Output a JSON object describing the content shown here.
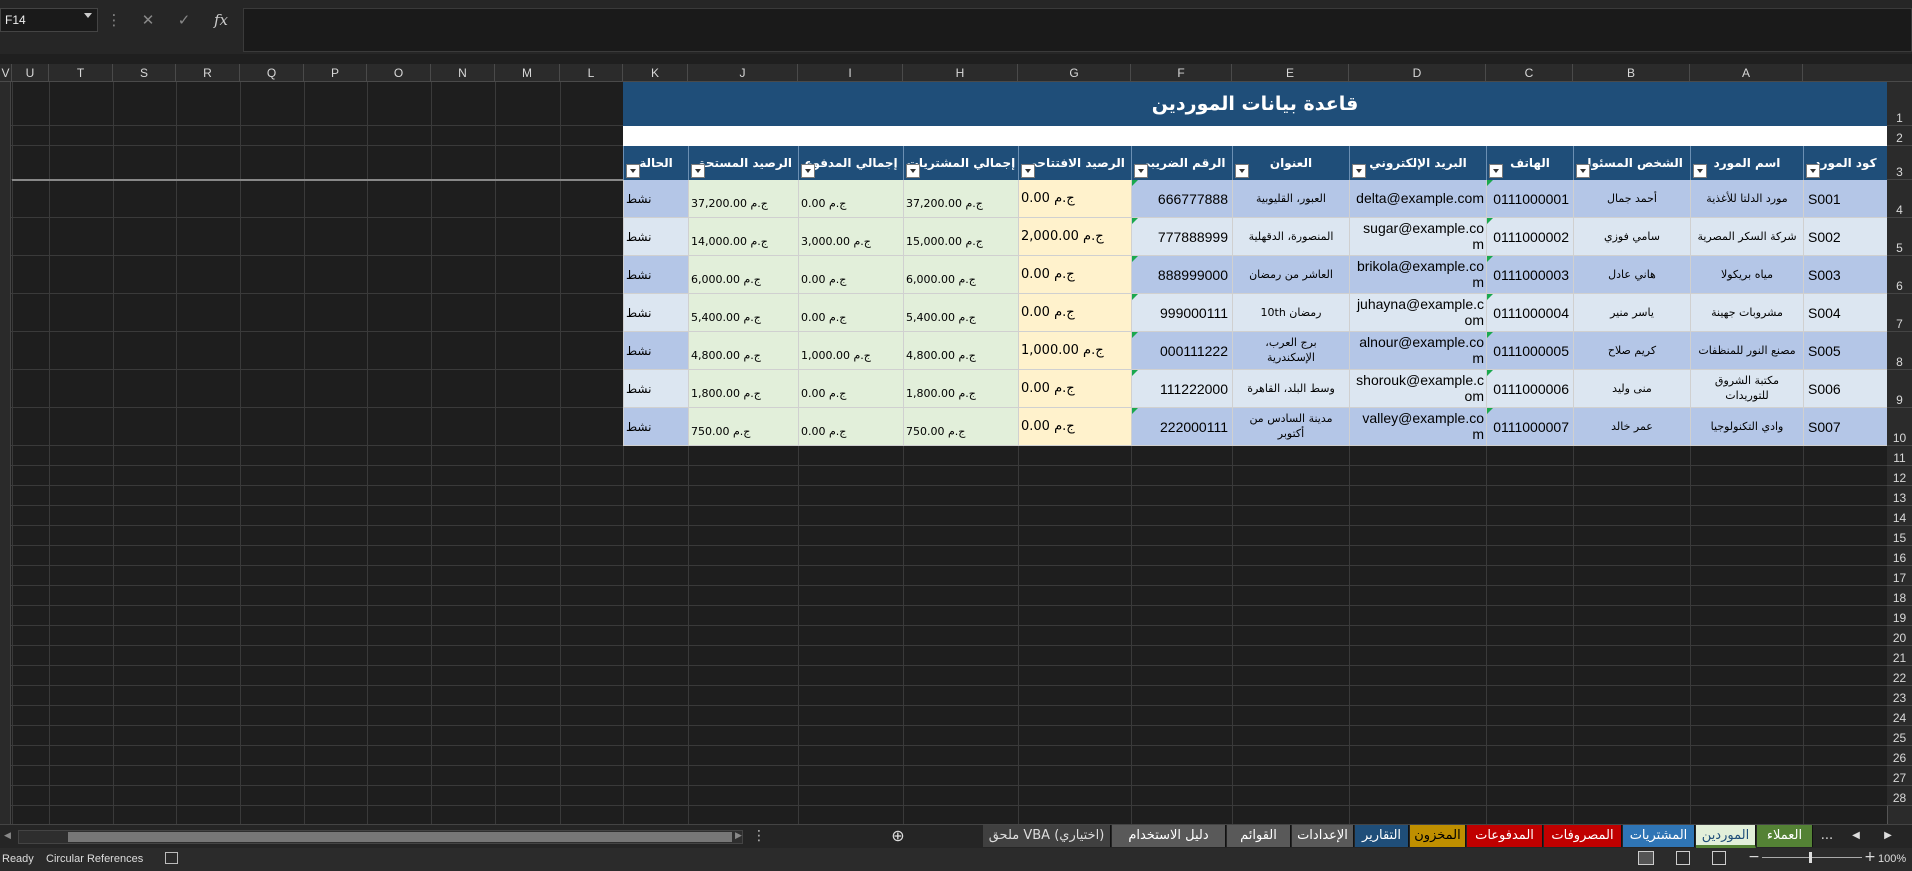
{
  "formula_bar": {
    "name_box": "F14",
    "fx_label": "fx",
    "cancel_icon": "✕",
    "enter_icon": "✓",
    "more_icon": "⋮",
    "formula": ""
  },
  "columns": [
    "V",
    "U",
    "T",
    "S",
    "R",
    "Q",
    "P",
    "O",
    "N",
    "M",
    "L",
    "K",
    "J",
    "I",
    "H",
    "G",
    "F",
    "E",
    "D",
    "C",
    "B",
    "A"
  ],
  "rows": [
    "1",
    "2",
    "3",
    "4",
    "5",
    "6",
    "7",
    "8",
    "9",
    "10",
    "11",
    "12",
    "13",
    "14",
    "15",
    "16",
    "17",
    "18",
    "19",
    "20",
    "21",
    "22",
    "23",
    "24",
    "25",
    "26",
    "27",
    "28"
  ],
  "sheet": {
    "title": "قاعدة بيانات الموردين",
    "headers": [
      "كود المورد",
      "اسم المورد",
      "الشخص المسئول",
      "الهاتف",
      "البريد الإلكتروني",
      "العنوان",
      "الرقم الضريبي",
      "الرصيد الافتتاحي",
      "إجمالي المشتريات",
      "إجمالي المدفوع",
      "الرصيد المستحق",
      "الحالة"
    ],
    "records": [
      {
        "code": "S001",
        "name": "مورد الدلتا للأغذية",
        "contact": "أحمد جمال",
        "phone": "0111000001",
        "email1": "delta@example.com",
        "email2": "",
        "address1": "العبور، القليوبية",
        "address2": "",
        "tax": "666777888",
        "opening": "ج.م 0.00",
        "purchases": "ج.م 37,200.00",
        "paid": "ج.م 0.00",
        "due": "ج.م 37,200.00",
        "status": "نشط"
      },
      {
        "code": "S002",
        "name": "شركة السكر المصرية",
        "contact": "سامي فوزي",
        "phone": "0111000002",
        "email1": "sugar@example.co",
        "email2": "m",
        "address1": "المنصورة، الدقهلية",
        "address2": "",
        "tax": "777888999",
        "opening": "ج.م 2,000.00",
        "purchases": "ج.م 15,000.00",
        "paid": "ج.م 3,000.00",
        "due": "ج.م 14,000.00",
        "status": "نشط"
      },
      {
        "code": "S003",
        "name": "مياه بريكولا",
        "contact": "هاني عادل",
        "phone": "0111000003",
        "email1": "brikola@example.co",
        "email2": "m",
        "address1": "العاشر من رمضان",
        "address2": "",
        "tax": "888999000",
        "opening": "ج.م 0.00",
        "purchases": "ج.م 6,000.00",
        "paid": "ج.م 0.00",
        "due": "ج.م 6,000.00",
        "status": "نشط"
      },
      {
        "code": "S004",
        "name": "مشروبات جهينة",
        "contact": "ياسر منير",
        "phone": "0111000004",
        "email1": "juhayna@example.c",
        "email2": "om",
        "address1": "رمضان 10th",
        "address2": "",
        "tax": "999000111",
        "opening": "ج.م 0.00",
        "purchases": "ج.م 5,400.00",
        "paid": "ج.م 0.00",
        "due": "ج.م 5,400.00",
        "status": "نشط"
      },
      {
        "code": "S005",
        "name": "مصنع النور للمنظفات",
        "contact": "كريم صلاح",
        "phone": "0111000005",
        "email1": "alnour@example.co",
        "email2": "m",
        "address1": "برج العرب،",
        "address2": "الإسكندرية",
        "tax": "000111222",
        "opening": "ج.م 1,000.00",
        "purchases": "ج.م 4,800.00",
        "paid": "ج.م 1,000.00",
        "due": "ج.م 4,800.00",
        "status": "نشط"
      },
      {
        "code": "S006",
        "name": "مكتبة الشروق",
        "name2": "للتوريدات",
        "contact": "منى وليد",
        "phone": "0111000006",
        "email1": "shorouk@example.c",
        "email2": "om",
        "address1": "وسط البلد، القاهرة",
        "address2": "",
        "tax": "111222000",
        "opening": "ج.م 0.00",
        "purchases": "ج.م 1,800.00",
        "paid": "ج.م 0.00",
        "due": "ج.م 1,800.00",
        "status": "نشط"
      },
      {
        "code": "S007",
        "name": "وادي التكنولوجيا",
        "contact": "عمر خالد",
        "phone": "0111000007",
        "email1": "valley@example.co",
        "email2": "m",
        "address1": "مدينة السادس من",
        "address2": "أكتوبر",
        "tax": "222000111",
        "opening": "ج.م 0.00",
        "purchases": "ج.م 750.00",
        "paid": "ج.م 0.00",
        "due": "ج.م 750.00",
        "status": "نشط"
      }
    ]
  },
  "tabs": [
    {
      "label": "العملاء",
      "color": "#548235",
      "text": "#ffffff",
      "active": false
    },
    {
      "label": "الموردين",
      "color": "#e2efda",
      "text": "#1f4e79",
      "active": true
    },
    {
      "label": "المشتريات",
      "color": "#2f75b5",
      "text": "#ffffff",
      "active": false
    },
    {
      "label": "المصروفات",
      "color": "#c00000",
      "text": "#ffffff",
      "active": false
    },
    {
      "label": "المدفوعات",
      "color": "#c00000",
      "text": "#ffffff",
      "active": false
    },
    {
      "label": "المخزون",
      "color": "#bf8f00",
      "text": "#000000",
      "active": false
    },
    {
      "label": "التقارير",
      "color": "#1f4e79",
      "text": "#ffffff",
      "active": false
    },
    {
      "label": "الإعدادات",
      "color": "#595959",
      "text": "#ffffff",
      "active": false
    },
    {
      "label": "القوائم",
      "color": "#595959",
      "text": "#ffffff",
      "active": false
    },
    {
      "label": "دليل الاستخدام",
      "color": "#595959",
      "text": "#ffffff",
      "active": false
    },
    {
      "label": "ملحق VBA (اختياري)",
      "color": "#404040",
      "text": "#dddddd",
      "active": false
    }
  ],
  "tab_nav": {
    "more": "...",
    "prev": "◀",
    "next": "▶",
    "add": "⊕",
    "menu": "⋮"
  },
  "status": {
    "ready": "Ready",
    "circular": "Circular References",
    "zoom": "100%",
    "minus": "−",
    "plus": "+"
  },
  "colors": {
    "header_blue": "#1f4e79",
    "row_dark": "#b4c6e7",
    "row_light": "#dce6f1",
    "opening_yellow": "#fff2cc",
    "money_green": "#e2efda"
  }
}
